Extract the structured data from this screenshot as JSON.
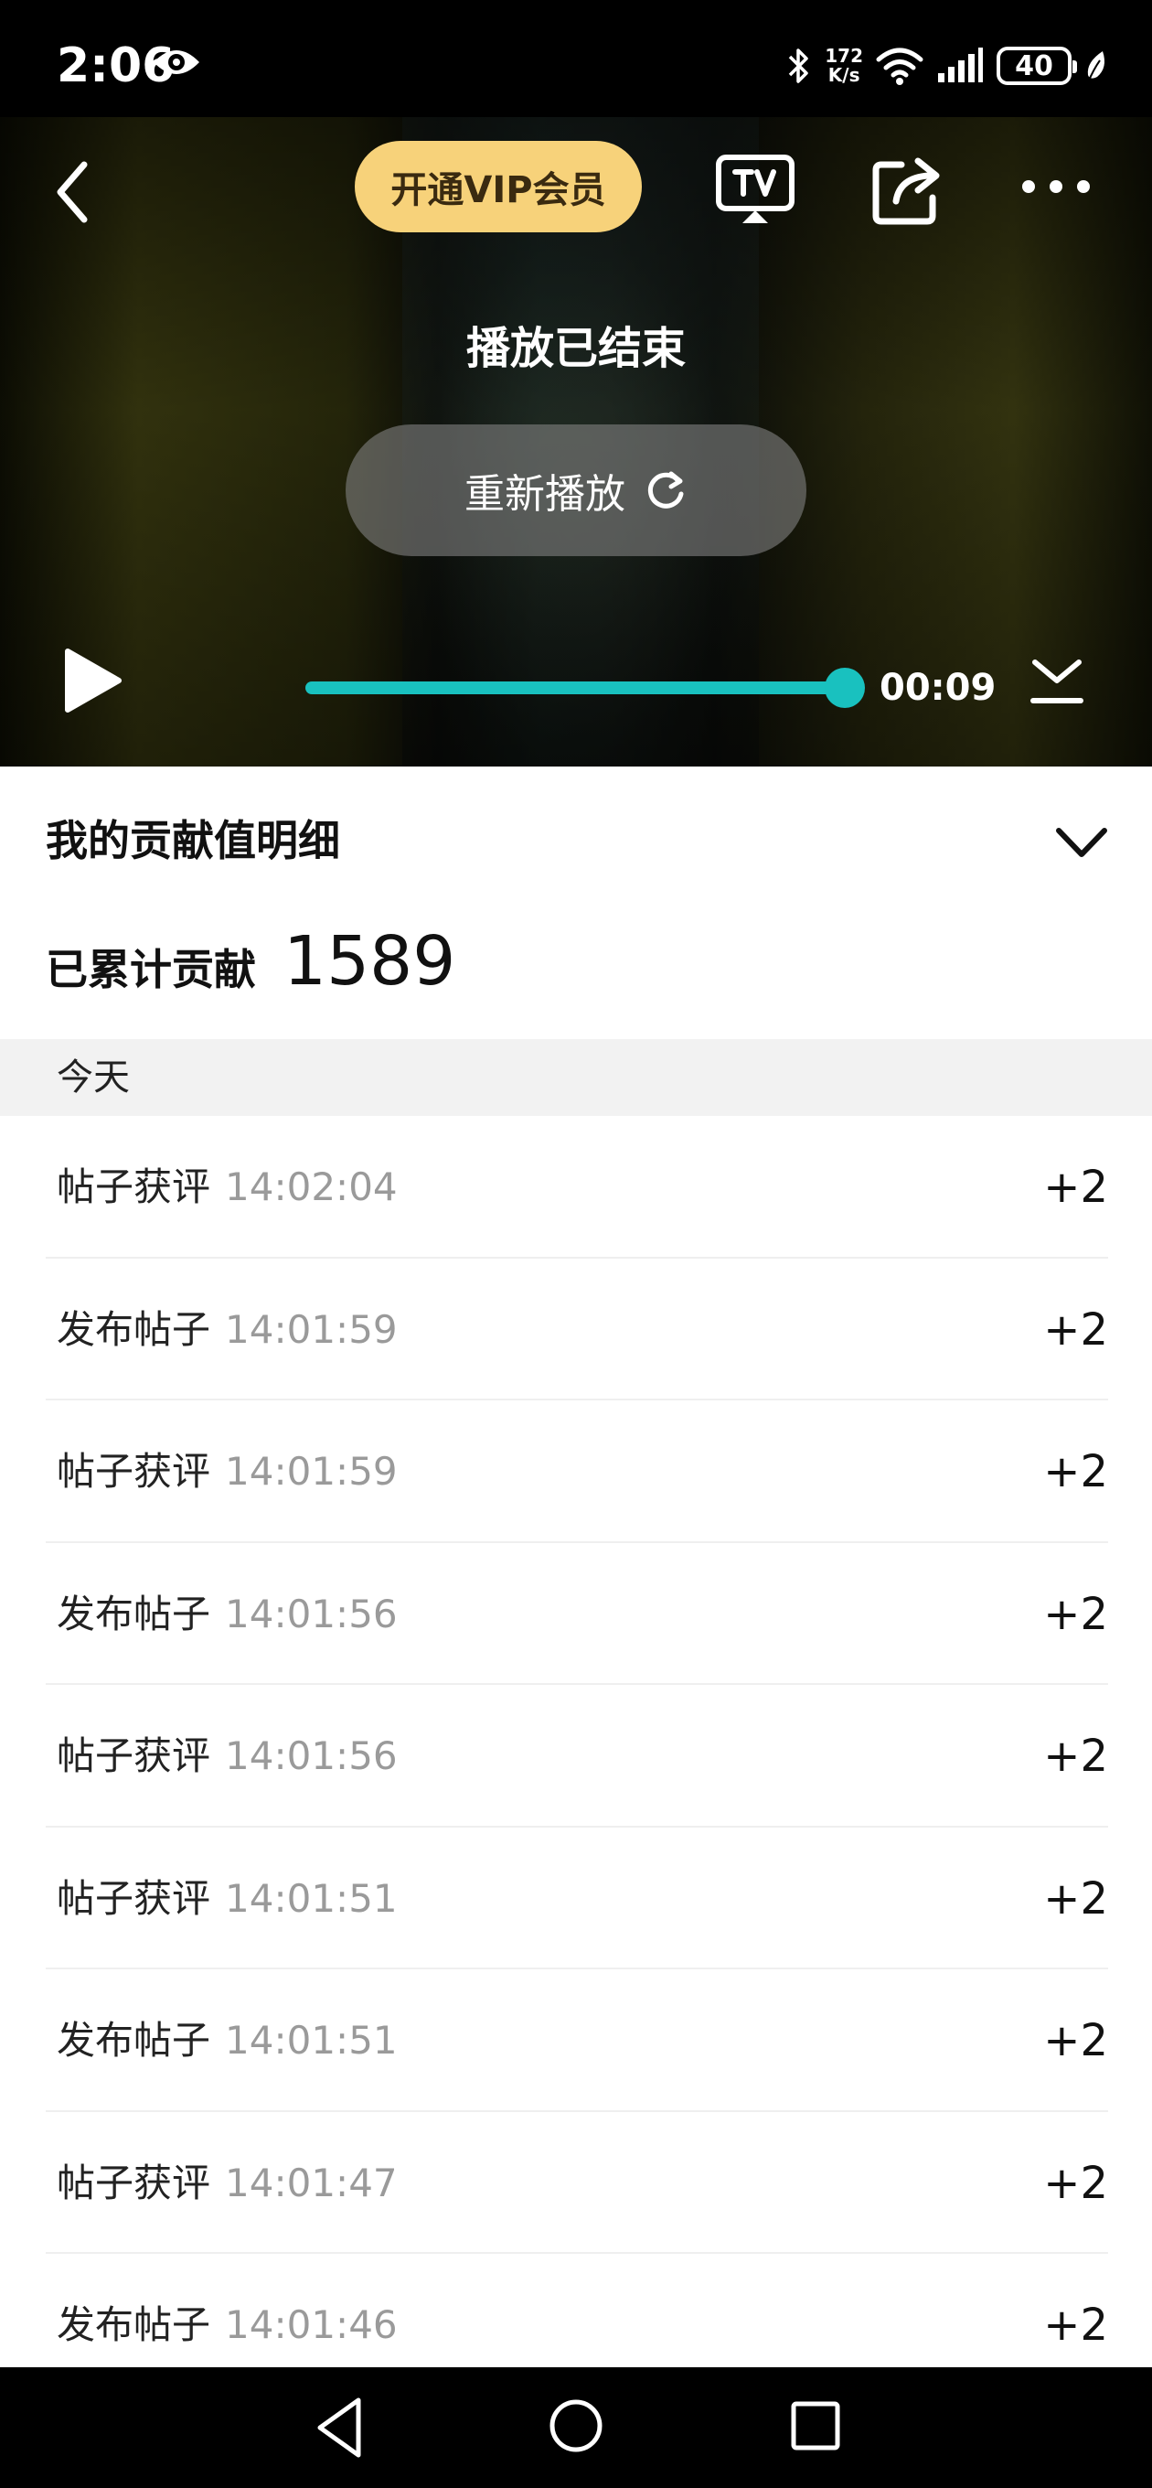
{
  "status_bar": {
    "time": "2:06",
    "net_speed_value": "172",
    "net_speed_unit": "K/s",
    "battery": "40",
    "icons": [
      "eye-icon",
      "bluetooth-icon",
      "wifi-icon",
      "signal-icon",
      "battery-icon",
      "leaf-icon"
    ]
  },
  "player": {
    "vip_label": "开通VIP会员",
    "ended_text": "播放已结束",
    "replay_label": "重新播放",
    "time": "00:09",
    "progress": 1.0,
    "accent_color": "#19c1bf"
  },
  "contribution": {
    "title": "我的贡献值明细",
    "total_label": "已累计贡献",
    "total_value": "1589",
    "date_label": "今天",
    "items": [
      {
        "label": "帖子获评",
        "time": "14:02:04",
        "points": "+2"
      },
      {
        "label": "发布帖子",
        "time": "14:01:59",
        "points": "+2"
      },
      {
        "label": "帖子获评",
        "time": "14:01:59",
        "points": "+2"
      },
      {
        "label": "发布帖子",
        "time": "14:01:56",
        "points": "+2"
      },
      {
        "label": "帖子获评",
        "time": "14:01:56",
        "points": "+2"
      },
      {
        "label": "帖子获评",
        "time": "14:01:51",
        "points": "+2"
      },
      {
        "label": "发布帖子",
        "time": "14:01:51",
        "points": "+2"
      },
      {
        "label": "帖子获评",
        "time": "14:01:47",
        "points": "+2"
      },
      {
        "label": "发布帖子",
        "time": "14:01:46",
        "points": "+2"
      }
    ]
  }
}
